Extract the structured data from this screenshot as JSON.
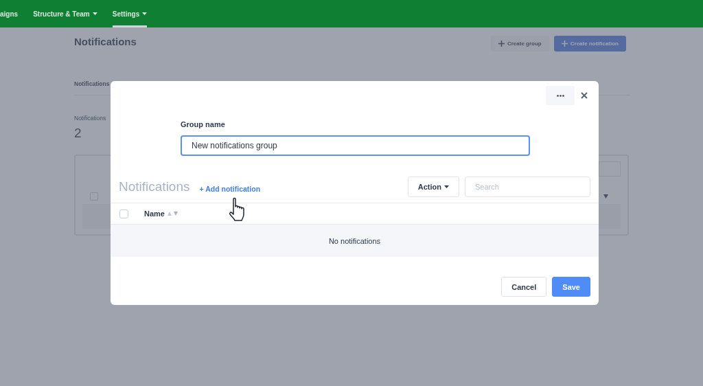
{
  "nav": {
    "items": [
      {
        "label": "aigns",
        "dropdown": false,
        "selected": false
      },
      {
        "label": "Structure & Team",
        "dropdown": true,
        "selected": false
      },
      {
        "label": "Settings",
        "dropdown": true,
        "selected": true
      }
    ]
  },
  "page": {
    "title": "Notifications",
    "buttons": [
      {
        "label": "Create group",
        "kind": "secondary"
      },
      {
        "label": "Create notification",
        "kind": "primary"
      }
    ],
    "tab_label": "Notifications",
    "table_checked": false,
    "stat_label": "Notifications",
    "stat_value": "2"
  },
  "modal": {
    "field_label": "Group name",
    "field_value": "New notifications group",
    "section_title": "Notifications",
    "add_link": "+ Add notification",
    "action": "Action",
    "search_placeholder": "Search",
    "columns": [
      "Name"
    ],
    "header_checked": false,
    "empty": "No notifications",
    "buttons": [
      {
        "label": "Cancel",
        "kind": "secondary"
      },
      {
        "label": "Save",
        "kind": "primary"
      }
    ]
  }
}
